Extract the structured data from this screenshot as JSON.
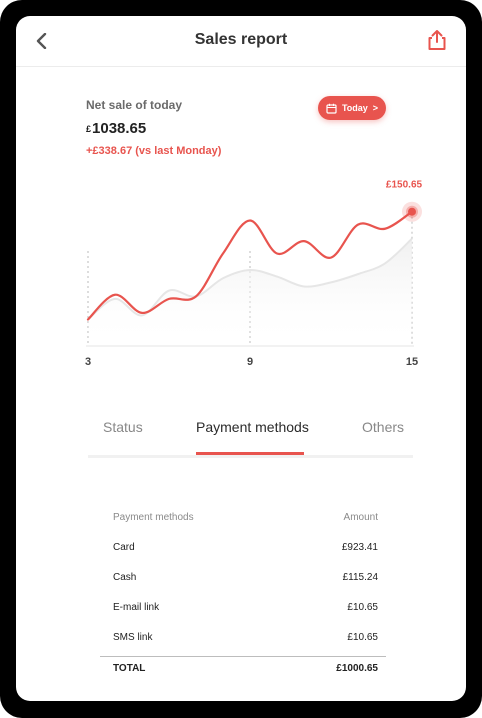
{
  "header": {
    "title": "Sales report",
    "back_icon": "chevron-left-icon",
    "share_icon": "share-icon"
  },
  "summary": {
    "label": "Net sale of today",
    "currency": "£",
    "amount": "1038.65",
    "delta": "+£338.67 (vs last Monday)"
  },
  "date_button": {
    "label": "Today",
    "icon": "calendar-icon",
    "chevron": ">"
  },
  "chart_data": {
    "type": "line",
    "x_ticks": [
      "3",
      "9",
      "15"
    ],
    "annotation": "£150.65",
    "accent": "#e8544e",
    "grid": false,
    "series": [
      {
        "values": [
          [
            3,
            20
          ],
          [
            4,
            50
          ],
          [
            5,
            28
          ],
          [
            6,
            45
          ],
          [
            7,
            48
          ],
          [
            8,
            100
          ],
          [
            9,
            140
          ],
          [
            10,
            100
          ],
          [
            11,
            115
          ],
          [
            12,
            95
          ],
          [
            13,
            135
          ],
          [
            14,
            130
          ],
          [
            15,
            150.65
          ]
        ]
      },
      {
        "values": [
          [
            3,
            20
          ],
          [
            4,
            45
          ],
          [
            5,
            25
          ],
          [
            6,
            55
          ],
          [
            7,
            48
          ],
          [
            8,
            70
          ],
          [
            9,
            80
          ],
          [
            10,
            72
          ],
          [
            11,
            60
          ],
          [
            12,
            65
          ],
          [
            13,
            75
          ],
          [
            14,
            88
          ],
          [
            15,
            118
          ]
        ]
      }
    ]
  },
  "tabs": [
    {
      "label": "Status"
    },
    {
      "label": "Payment methods",
      "active": true
    },
    {
      "label": "Others"
    }
  ],
  "table": {
    "headers": [
      "Payment methods",
      "Amount"
    ],
    "rows": [
      {
        "method": "Card",
        "amount": "£923.41"
      },
      {
        "method": "Cash",
        "amount": "£115.24"
      },
      {
        "method": "E-mail link",
        "amount": "£10.65"
      },
      {
        "method": "SMS link",
        "amount": "£10.65"
      }
    ],
    "total": {
      "label": "TOTAL",
      "amount": "£1000.65"
    }
  }
}
